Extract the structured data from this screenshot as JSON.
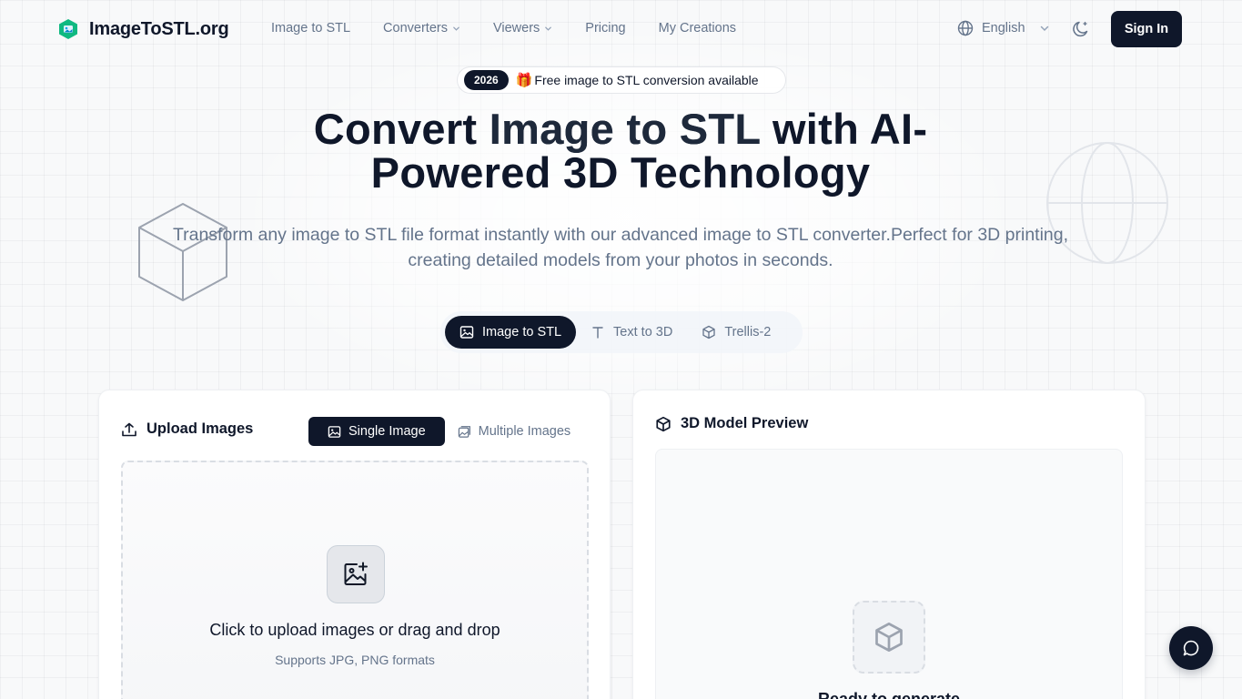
{
  "brand": {
    "name": "ImageToSTL.org"
  },
  "nav": {
    "items": [
      {
        "label": "Image to STL",
        "has_dropdown": false
      },
      {
        "label": "Converters",
        "has_dropdown": true
      },
      {
        "label": "Viewers",
        "has_dropdown": true
      },
      {
        "label": "Pricing",
        "has_dropdown": false
      },
      {
        "label": "My Creations",
        "has_dropdown": false
      }
    ],
    "language": "English",
    "signin_label": "Sign In"
  },
  "badge": {
    "year": "2026",
    "emoji": "🎁",
    "text": "Free image to STL conversion available"
  },
  "hero": {
    "title_part1": "Convert ",
    "title_accent": "Image to STL",
    "title_part2": " with AI-",
    "title_line2": "Powered 3D Technology",
    "subtitle_line1": "Transform any image to STL file format instantly with our advanced image to STL converter.Perfect for 3D printing,",
    "subtitle_line2": "creating detailed models from your photos in seconds."
  },
  "modes": [
    {
      "label": "Image to STL",
      "icon": "image-icon",
      "active": true
    },
    {
      "label": "Text to 3D",
      "icon": "text-icon",
      "active": false
    },
    {
      "label": "Trellis-2",
      "icon": "cube-icon",
      "active": false
    }
  ],
  "upload": {
    "title": "Upload Images",
    "toggle": [
      {
        "label": "Single Image",
        "active": true
      },
      {
        "label": "Multiple Images",
        "active": false
      }
    ],
    "drop_title": "Click to upload images or drag and drop",
    "drop_hint": "Supports JPG, PNG formats"
  },
  "preview": {
    "title": "3D Model Preview",
    "status": "Ready to generate"
  },
  "colors": {
    "primary": "#0f172a",
    "muted": "#64748b",
    "background": "#f8f9fa"
  }
}
